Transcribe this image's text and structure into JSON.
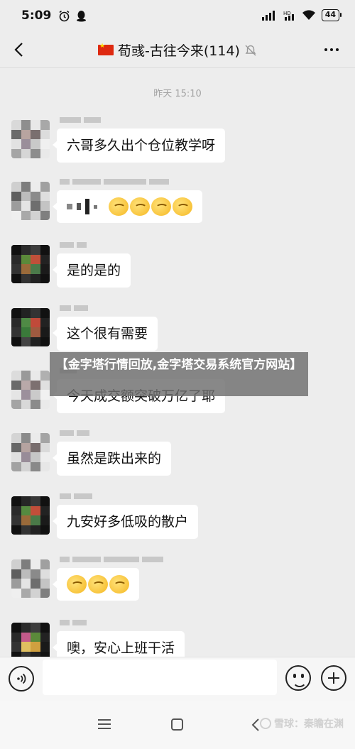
{
  "status_bar": {
    "time": "5:09",
    "battery": "44"
  },
  "header": {
    "title": "荀彧-古往今来(114)"
  },
  "chat": {
    "timestamp": "昨天 15:10",
    "messages": [
      {
        "text": "六哥多久出个仓位教学呀"
      },
      {
        "text": "",
        "emoji_count": 4
      },
      {
        "text": "是的是的"
      },
      {
        "text": "这个很有需要"
      },
      {
        "text": "今天成交额突破万亿了耶"
      },
      {
        "text": "虽然是跌出来的"
      },
      {
        "text": "九安好多低吸的散户"
      },
      {
        "text": "",
        "emoji_count": 3
      },
      {
        "text": "噢，安心上班干活"
      }
    ]
  },
  "overlay": {
    "banner": "【金字塔行情回放,金字塔交易系统官方网站】"
  },
  "nav": {
    "watermark": "雪球：秦瞻在渊"
  },
  "icons": {
    "status_left": [
      "alarm-icon",
      "qq-icon"
    ],
    "status_right": [
      "signal-icon",
      "wifi-icon",
      "battery-icon"
    ]
  },
  "colors": {
    "background": "#ededed",
    "bubble": "#ffffff",
    "flag_red": "#de2910"
  }
}
